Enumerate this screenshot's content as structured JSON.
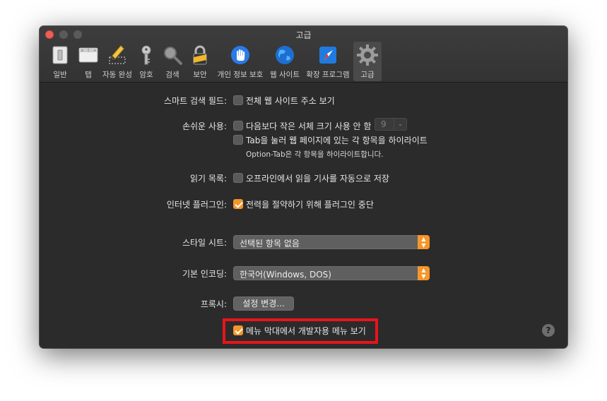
{
  "window": {
    "title": "고급"
  },
  "toolbar": {
    "items": [
      {
        "label": "일반",
        "icon": "switch-icon"
      },
      {
        "label": "탭",
        "icon": "tabs-icon"
      },
      {
        "label": "자동 완성",
        "icon": "pencil-icon"
      },
      {
        "label": "암호",
        "icon": "key-icon"
      },
      {
        "label": "검색",
        "icon": "magnifier-icon"
      },
      {
        "label": "보안",
        "icon": "lock-icon"
      },
      {
        "label": "개인 정보 보호",
        "icon": "hand-icon"
      },
      {
        "label": "웹 사이트",
        "icon": "globe-icon"
      },
      {
        "label": "확장 프로그램",
        "icon": "puzzle-icon"
      },
      {
        "label": "고급",
        "icon": "gear-icon",
        "active": true
      }
    ]
  },
  "smart_search": {
    "label": "스마트 검색 필드:",
    "show_full_address": {
      "text": "전체 웹 사이트 주소 보기",
      "checked": false
    }
  },
  "accessibility": {
    "label": "손쉬운 사용:",
    "min_font": {
      "text": "다음보다 작은 서체 크기 사용 안 함",
      "checked": false,
      "value": "9"
    },
    "tab_highlight": {
      "text": "Tab을 눌러 웹 페이지에 있는 각 항목을 하이라이트",
      "checked": false
    },
    "note": "Option-Tab은 각 항목을 하이라이트합니다."
  },
  "reading_list": {
    "label": "읽기 목록:",
    "save_offline": {
      "text": "오프라인에서 읽을 기사를 자동으로 저장",
      "checked": false
    }
  },
  "plugins": {
    "label": "인터넷 플러그인:",
    "stop_plugins": {
      "text": "전력을 절약하기 위해 플러그인 중단",
      "checked": true
    }
  },
  "style_sheet": {
    "label": "스타일 시트:",
    "value": "선택된 항목 없음"
  },
  "encoding": {
    "label": "기본 인코딩:",
    "value": "한국어(Windows, DOS)"
  },
  "proxies": {
    "label": "프록시:",
    "button": "설정 변경..."
  },
  "develop_menu": {
    "text": "메뉴 막대에서 개발자용 메뉴 보기",
    "checked": true
  },
  "help": {
    "label": "?"
  },
  "colors": {
    "accent": "#f5962a",
    "highlight": "#e8141b"
  }
}
